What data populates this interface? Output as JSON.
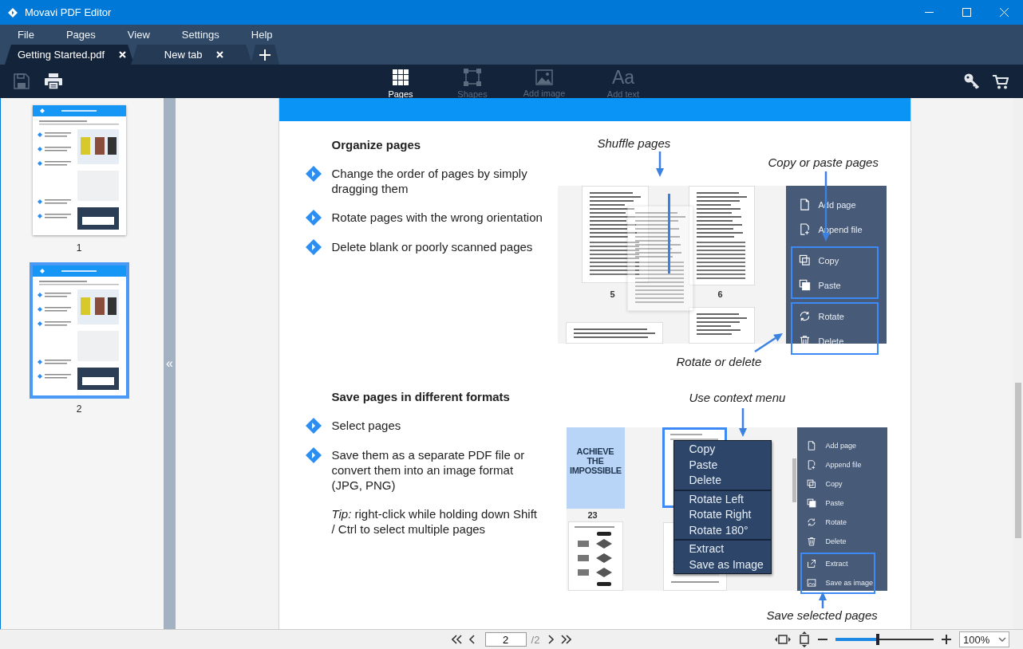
{
  "window": {
    "title": "Movavi PDF Editor"
  },
  "menu": [
    "File",
    "Pages",
    "View",
    "Settings",
    "Help"
  ],
  "tabs": [
    {
      "label": "Getting Started.pdf",
      "selected": true
    },
    {
      "label": "New tab",
      "selected": false
    }
  ],
  "toolbar": {
    "file_actions": [
      {
        "kind": "save",
        "disabled": true
      },
      {
        "kind": "print",
        "disabled": false
      }
    ],
    "tools": [
      {
        "kind": "pages",
        "label": "Pages",
        "disabled": false
      },
      {
        "kind": "shapes",
        "label": "Shapes",
        "disabled": true
      },
      {
        "kind": "image",
        "label": "Add image",
        "disabled": true
      },
      {
        "kind": "text",
        "label": "Add text",
        "glyph": "Aa",
        "disabled": true
      }
    ]
  },
  "sidebar": {
    "thumbnails": [
      {
        "label": "1",
        "selected": false
      },
      {
        "label": "2",
        "selected": true
      }
    ],
    "collapse": "«"
  },
  "document": {
    "sections": [
      {
        "heading": "Organize pages",
        "items": [
          {
            "kind": "bullet",
            "text": "Change the order of pages by simply dragging them"
          },
          {
            "kind": "bullet",
            "text": "Rotate pages with the wrong orientation"
          },
          {
            "kind": "bullet",
            "text": "Delete blank or poorly scanned pages"
          }
        ],
        "figure": {
          "kind": "shuffle",
          "captions": [
            "Shuffle pages",
            "Copy or paste pages",
            "Rotate or delete"
          ],
          "page_numbers": [
            "5",
            "6"
          ],
          "panel": [
            {
              "highlighted": false,
              "items": [
                {
                  "kind": "page",
                  "label": "Add page"
                },
                {
                  "kind": "append",
                  "label": "Append file"
                }
              ]
            },
            {
              "highlighted": true,
              "items": [
                {
                  "kind": "copy",
                  "label": "Copy"
                },
                {
                  "kind": "paste",
                  "label": "Paste"
                }
              ]
            },
            {
              "highlighted": true,
              "items": [
                {
                  "kind": "rotate",
                  "label": "Rotate"
                },
                {
                  "kind": "delete",
                  "label": "Delete"
                }
              ]
            }
          ]
        }
      },
      {
        "heading": "Save pages in different formats",
        "items": [
          {
            "kind": "bullet",
            "text": "Select pages"
          },
          {
            "kind": "bullet",
            "text": "Save them as a separate PDF file or convert them into an image format (JPG, PNG)"
          },
          {
            "kind": "note",
            "text": "*Tip:* right-click while holding down Shift / Ctrl to select multiple pages"
          }
        ],
        "figure": {
          "kind": "context",
          "captions": [
            "Use context menu",
            "Save selected pages"
          ],
          "cover": {
            "title": "ACHIEVE THE IMPOSSIBLE",
            "page_number": "23"
          },
          "context_menu": [
            [
              "Copy",
              "Paste",
              "Delete"
            ],
            [
              "Rotate Left",
              "Rotate Right",
              "Rotate 180°"
            ],
            [
              "Extract",
              "Save as Image"
            ]
          ],
          "panel": [
            {
              "highlighted": false,
              "items": [
                {
                  "kind": "page",
                  "label": "Add page"
                },
                {
                  "kind": "append",
                  "label": "Append file"
                },
                {
                  "kind": "copy",
                  "label": "Copy"
                },
                {
                  "kind": "paste",
                  "label": "Paste"
                },
                {
                  "kind": "rotate",
                  "label": "Rotate"
                },
                {
                  "kind": "delete",
                  "label": "Delete"
                }
              ]
            },
            {
              "highlighted": true,
              "items": [
                {
                  "kind": "extract",
                  "label": "Extract"
                },
                {
                  "kind": "image",
                  "label": "Save as image"
                }
              ]
            }
          ]
        }
      }
    ]
  },
  "status_bar": {
    "page": "2",
    "page_count": "/2",
    "zoom": {
      "level": 0.43,
      "value": "100%"
    }
  }
}
